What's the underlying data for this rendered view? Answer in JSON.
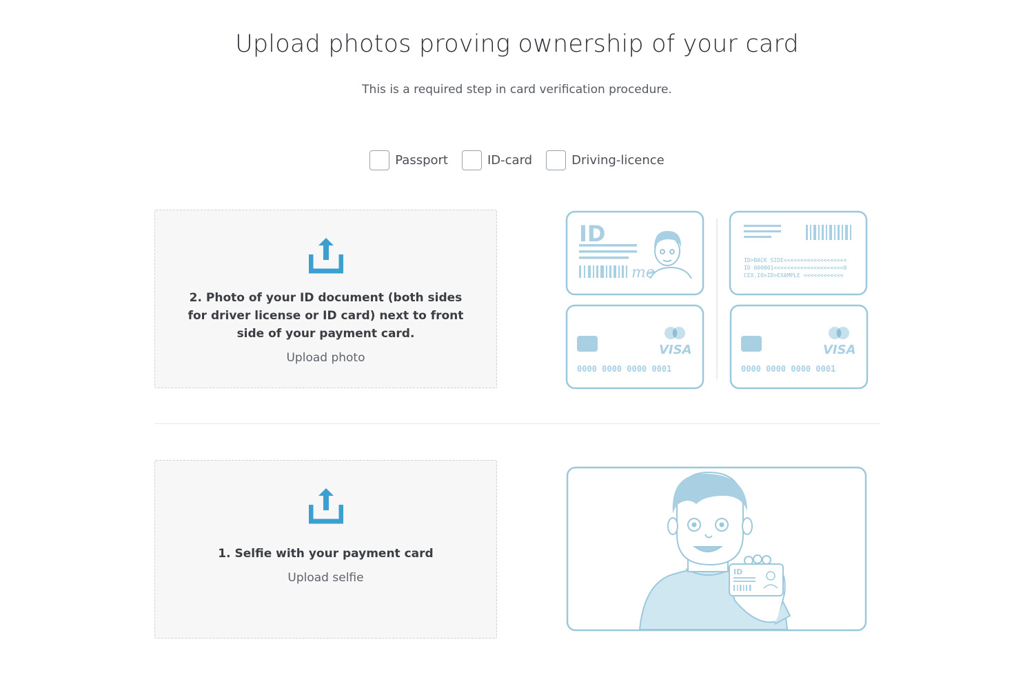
{
  "header": {
    "title": "Upload photos proving ownership of your card",
    "subtitle": "This is a required step in card verification procedure."
  },
  "document_types": [
    {
      "label": "Passport",
      "checked": false
    },
    {
      "label": "ID-card",
      "checked": false
    },
    {
      "label": "Driving-licence",
      "checked": false
    }
  ],
  "uploads": [
    {
      "text": "2. Photo of your ID document (both sides for driver license or ID card) next to front side of your payment card.",
      "action": "Upload photo"
    },
    {
      "text": "1. Selfie with your payment card",
      "action": "Upload selfie"
    }
  ],
  "illustration_cards": {
    "id_front_title": "ID",
    "id_front_signature": "me",
    "id_back_lines": [
      "ID>BACK SIDE<<<<<<<<<<<<<<<<<<<",
      "ID 000001<<<<<<<<<<<<<<<<<<<<<0",
      "CEX.IO>ID>EXAMPLE <<<<<<<<<<<<"
    ],
    "card_brand": "VISA",
    "card_number": "0000 0000 0000 0001",
    "selfie_card_title": "ID"
  },
  "colors": {
    "accent": "#3d9fd0",
    "illustration_stroke": "#9cc8dc",
    "illustration_fill": "#a9cfe3",
    "upload_bg": "#f7f7f7"
  }
}
